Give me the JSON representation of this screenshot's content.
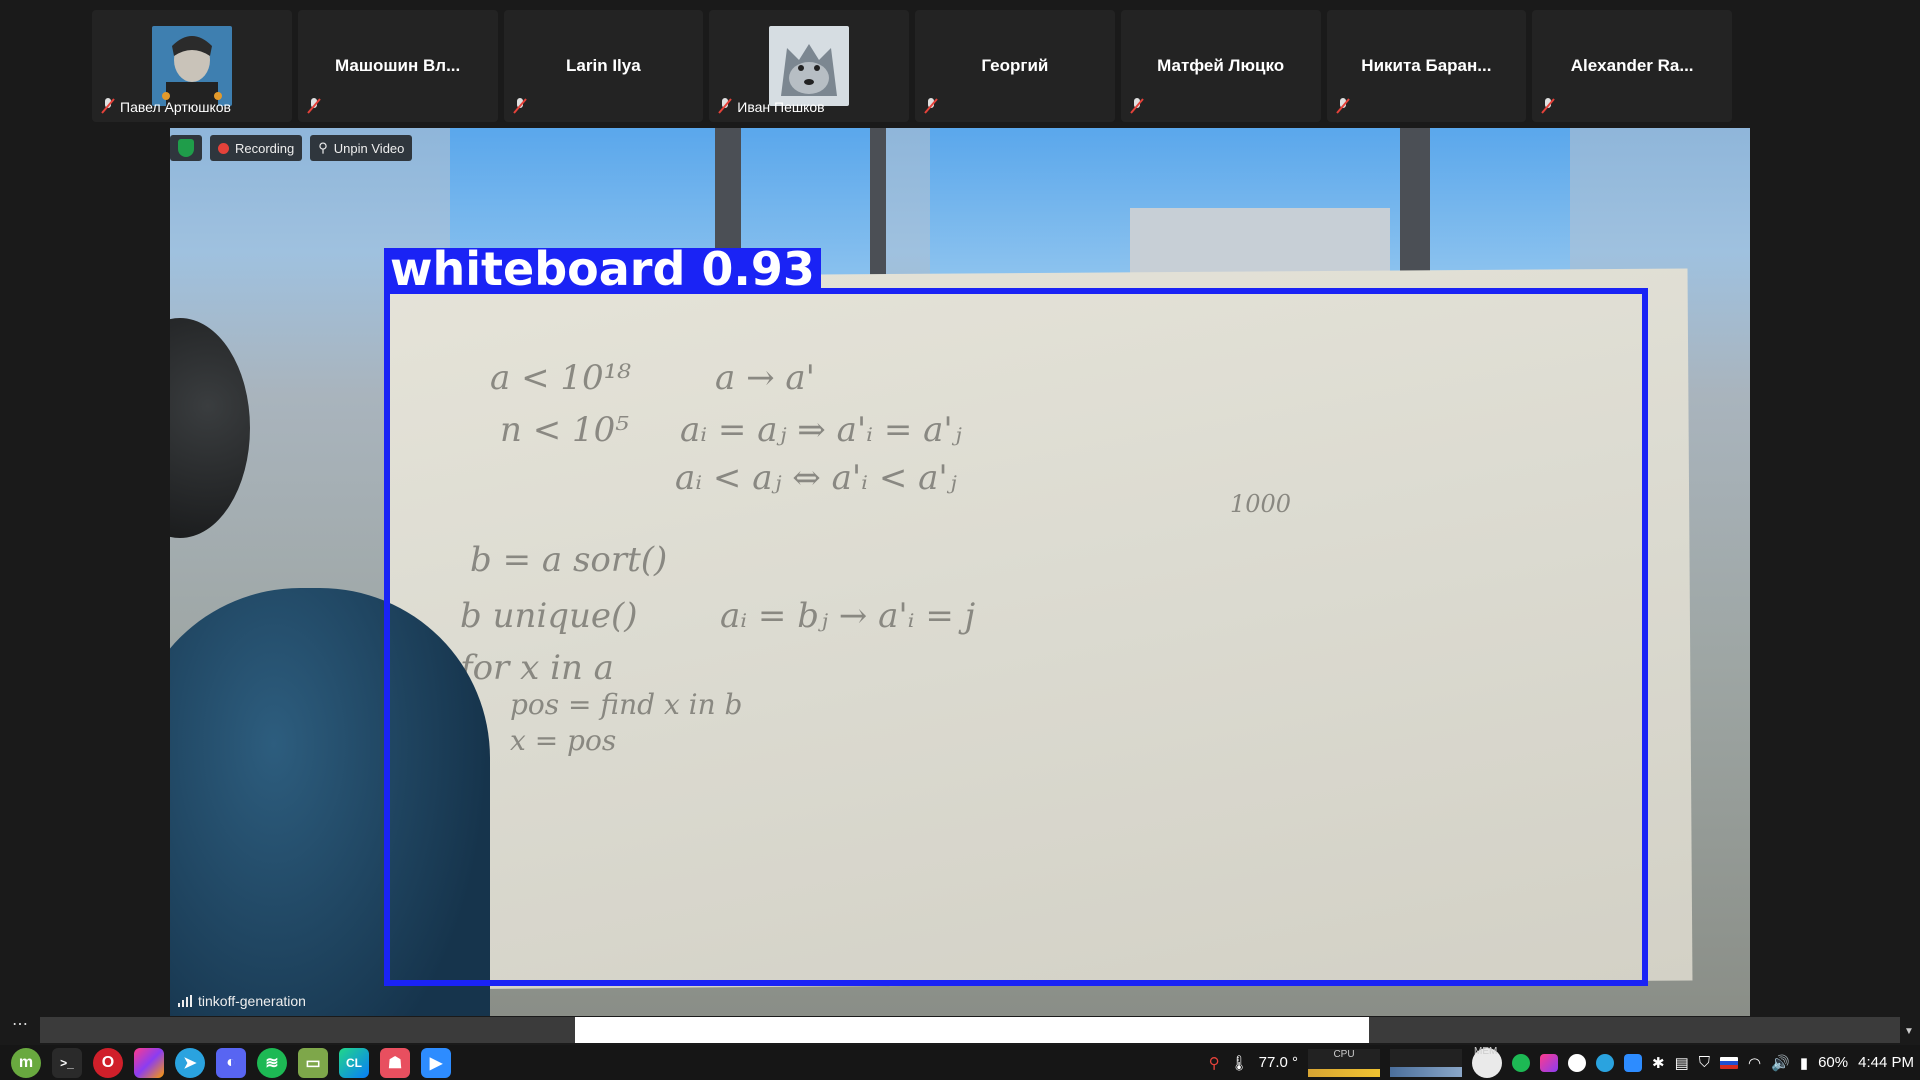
{
  "participants": [
    {
      "name": "Павел Артюшков",
      "has_avatar": true,
      "avatar": "avatar-photo"
    },
    {
      "name": "Машошин Вл...",
      "has_avatar": false
    },
    {
      "name": "Larin Ilya",
      "has_avatar": false
    },
    {
      "name": "Иван Пешков",
      "has_avatar": true,
      "avatar": "wolf-avatar"
    },
    {
      "name": "Георгий",
      "has_avatar": false
    },
    {
      "name": "Матфей Люцко",
      "has_avatar": false
    },
    {
      "name": "Никита Баран...",
      "has_avatar": false
    },
    {
      "name": "Alexander Ra...",
      "has_avatar": false
    }
  ],
  "video": {
    "recording_label": "Recording",
    "unpin_label": "Unpin Video",
    "network_name": "tinkoff-generation",
    "detection": {
      "label": "whiteboard 0.93",
      "color": "#1a23f5"
    },
    "handwriting": [
      "a < 10¹⁸",
      "a → a'",
      "n < 10⁵",
      "aᵢ = aⱼ ⇒ a'ᵢ = a'ⱼ",
      "aᵢ < aⱼ ⇔ a'ᵢ < a'ⱼ",
      "b = a sort()",
      "b unique()",
      "aᵢ = bⱼ → a'ᵢ = j",
      "for x in a",
      "pos = find x in b",
      "x = pos",
      "1000"
    ]
  },
  "scroll": {
    "dots": "⋯"
  },
  "taskbar": {
    "apps": [
      "mint-menu-icon",
      "terminal-icon",
      "opera-icon",
      "jetbrains-toolbox-icon",
      "telegram-icon",
      "discord-icon",
      "spotify-icon",
      "files-icon",
      "clion-icon",
      "gitkraken-icon",
      "zoom-icon"
    ],
    "weather": "77.0 °",
    "cpu_label": "CPU",
    "mem_label": "MEM",
    "battery": "60%",
    "time": "4:44 PM"
  },
  "colors": {
    "accent_blue": "#1a23f5",
    "recording": "#e5423a",
    "shield": "#1f9d4a"
  }
}
